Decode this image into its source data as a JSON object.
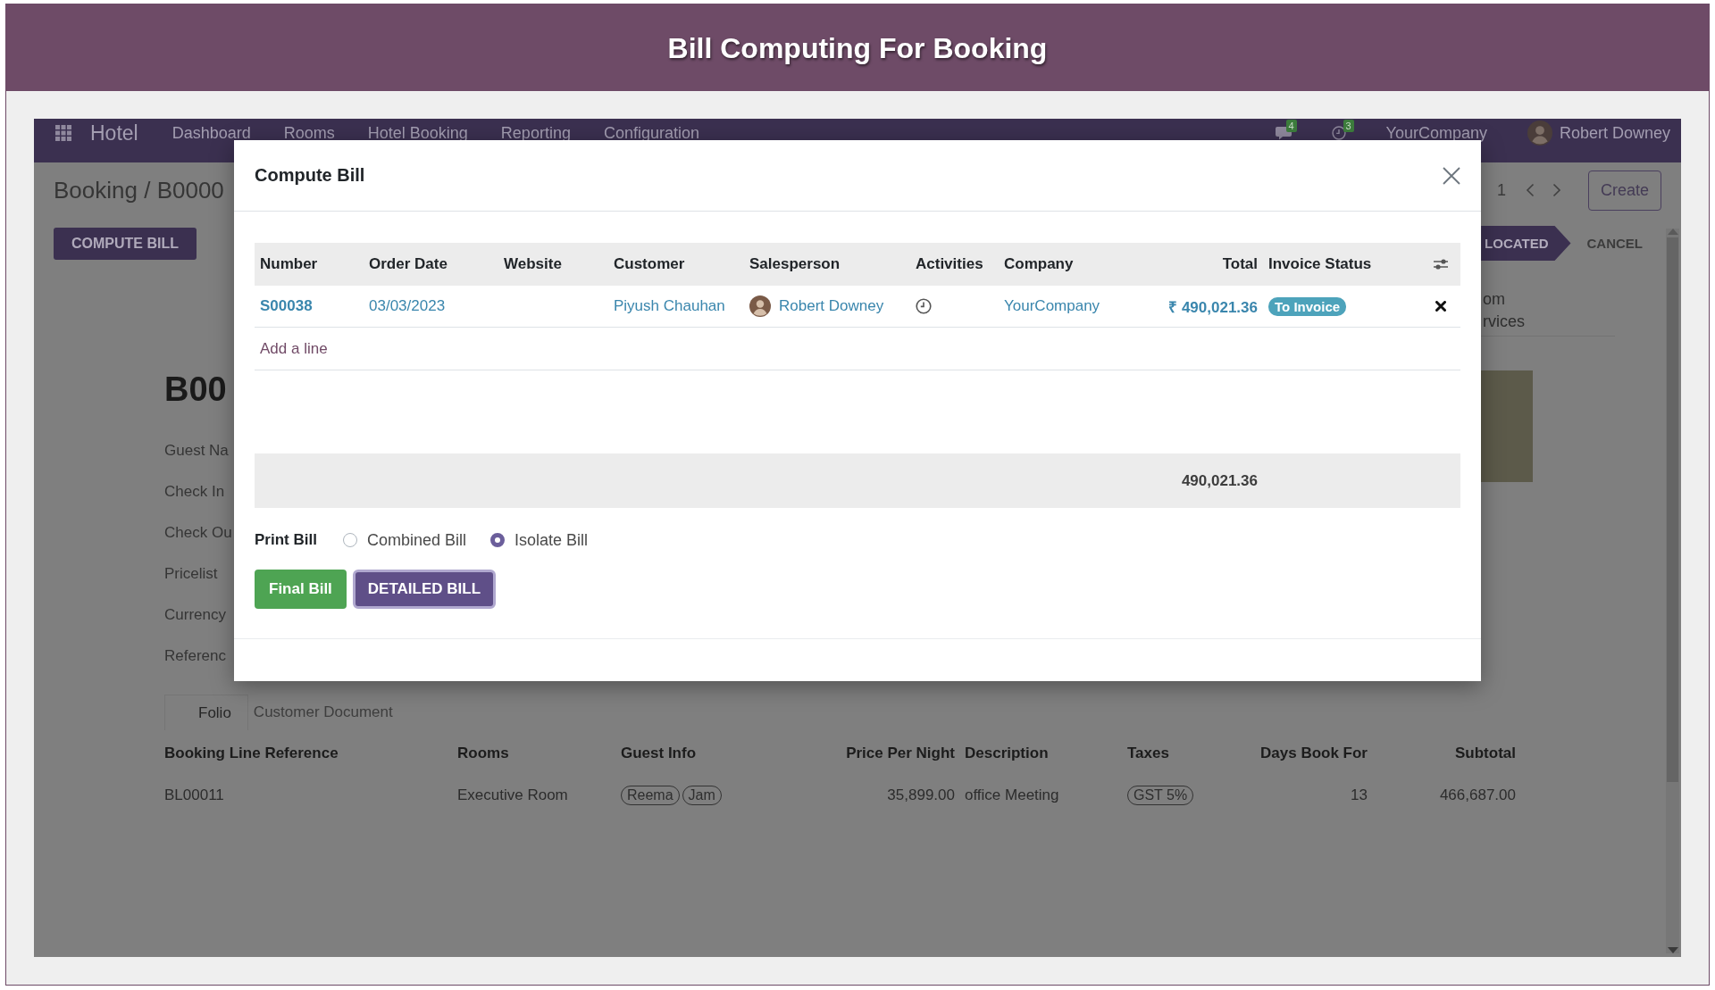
{
  "banner": {
    "title": "Bill Computing For Booking"
  },
  "navbar": {
    "app_name": "Hotel",
    "menu": [
      "Dashboard",
      "Rooms",
      "Hotel Booking",
      "Reporting",
      "Configuration"
    ],
    "messages_count": "4",
    "activities_count": "3",
    "company": "YourCompany",
    "user": "Robert Downey"
  },
  "control_panel": {
    "breadcrumb": "Booking / B0000",
    "pager": "1",
    "create_button": "Create"
  },
  "status_bar": {
    "action_button": "COMPUTE BILL",
    "stages": [
      {
        "label": "LOCATED",
        "selected": true
      },
      {
        "label": "CANCEL",
        "selected": false
      }
    ]
  },
  "form": {
    "smart_button": [
      "om",
      "rvices"
    ],
    "title": "B00",
    "fields": [
      "Guest Na",
      "Check In",
      "Check Ou",
      "Pricelist",
      "Currency",
      "Referenc"
    ],
    "tabs": [
      {
        "label": "Folio",
        "selected": true
      },
      {
        "label": "Customer Document",
        "selected": false
      }
    ],
    "lines": {
      "columns": [
        {
          "label": "Booking Line Reference",
          "kind": "text"
        },
        {
          "label": "Rooms",
          "kind": "text"
        },
        {
          "label": "Guest Info",
          "kind": "tags"
        },
        {
          "label": "Price Per Night",
          "kind": "number"
        },
        {
          "label": "Description",
          "kind": "text"
        },
        {
          "label": "Taxes",
          "kind": "tags"
        },
        {
          "label": "Days Book For",
          "kind": "number"
        },
        {
          "label": "Subtotal",
          "kind": "number"
        }
      ],
      "rows": [
        {
          "cells": [
            "BL00011",
            "Executive Room",
            [
              "Reema",
              "Jam"
            ],
            "35,899.00",
            "office Meeting",
            [
              "GST 5%"
            ],
            "13",
            "466,687.00"
          ]
        }
      ]
    }
  },
  "dialog": {
    "title": "Compute Bill",
    "columns": [
      {
        "label": "Number",
        "kind": "text"
      },
      {
        "label": "Order Date",
        "kind": "text"
      },
      {
        "label": "Website",
        "kind": "text"
      },
      {
        "label": "Customer",
        "kind": "text"
      },
      {
        "label": "Salesperson",
        "kind": "text"
      },
      {
        "label": "Activities",
        "kind": "text"
      },
      {
        "label": "Company",
        "kind": "text"
      },
      {
        "label": "Total",
        "kind": "number"
      },
      {
        "label": "Invoice Status",
        "kind": "text"
      }
    ],
    "rows": [
      {
        "number": "S00038",
        "order_date": "03/03/2023",
        "customer": "Piyush Chauhan",
        "salesperson": "Robert Downey",
        "company": "YourCompany",
        "total": "₹ 490,021.36",
        "invoice_status": "To Invoice"
      }
    ],
    "add_line": "Add a line",
    "grand_total": "490,021.36",
    "print_bill": {
      "label": "Print Bill",
      "options": [
        {
          "label": "Combined Bill",
          "selected": false
        },
        {
          "label": "Isolate Bill",
          "selected": true
        }
      ]
    },
    "buttons": [
      {
        "label": "Final Bill",
        "kind": "success",
        "focused": false
      },
      {
        "label": "DETAILED BILL",
        "kind": "primary",
        "focused": true
      }
    ]
  }
}
